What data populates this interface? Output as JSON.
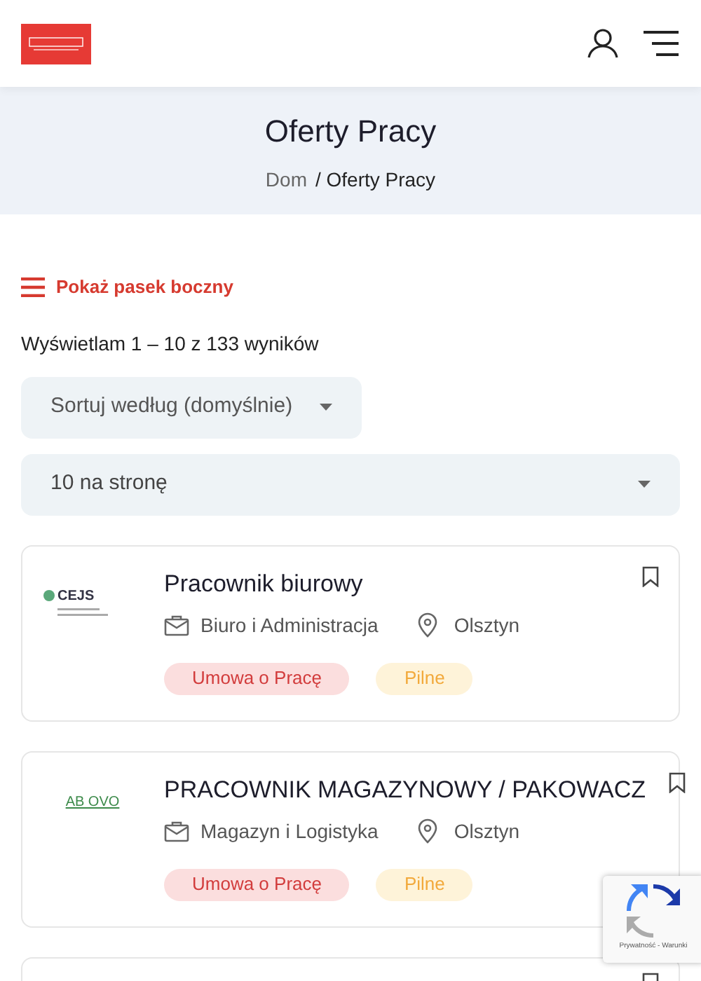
{
  "page_title": "Oferty Pracy",
  "breadcrumb": [
    {
      "label": "Dom",
      "current": false
    },
    {
      "label": "/ Oferty Pracy",
      "current": true
    }
  ],
  "sidebar_toggle": "Pokaż pasek boczny",
  "result_count": "Wyświetlam 1 – 10 z 133 wyników",
  "sort_select": {
    "value": "Sortuj według (domyślnie)"
  },
  "per_page_select": {
    "value": "10 na stronę"
  },
  "jobs": [
    {
      "logo": {
        "text": "CEJS",
        "kind": "cejs"
      },
      "title": "Pracownik biurowy",
      "category": "Biuro i Administracja",
      "location": "Olsztyn",
      "tags": [
        {
          "label": "Umowa o Pracę",
          "kind": "contract"
        },
        {
          "label": "Pilne",
          "kind": "urgent"
        }
      ]
    },
    {
      "logo": {
        "text": "AB OVO",
        "kind": "abovo"
      },
      "title": "PRACOWNIK MAGAZYNOWY / PAKOWACZ",
      "category": "Magazyn i Logistyka",
      "location": "Olsztyn",
      "tags": [
        {
          "label": "Umowa o Pracę",
          "kind": "contract"
        },
        {
          "label": "Pilne",
          "kind": "urgent"
        }
      ]
    }
  ],
  "recaptcha": {
    "links": "Prywatność - Warunki"
  }
}
